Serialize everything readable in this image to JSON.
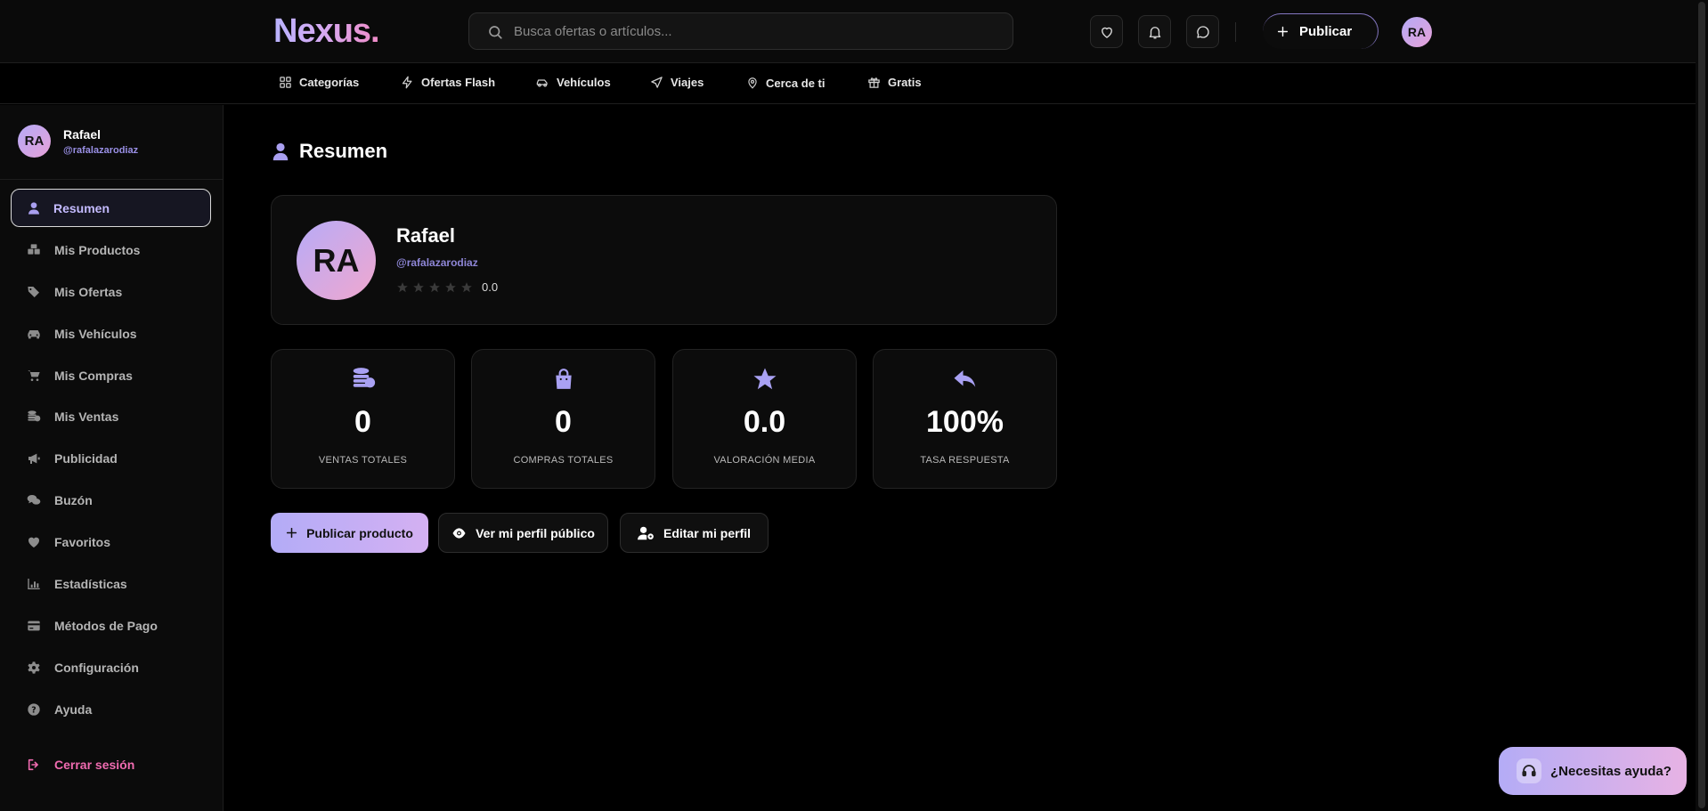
{
  "header": {
    "logo": "Nexus.",
    "search_placeholder": "Busca ofertas o artículos...",
    "publish_label": "Publicar",
    "avatar_initials": "RA"
  },
  "nav": {
    "items": [
      {
        "label": "Categorías",
        "icon": "grid-icon"
      },
      {
        "label": "Ofertas Flash",
        "icon": "lightning-icon"
      },
      {
        "label": "Vehículos",
        "icon": "car-icon"
      },
      {
        "label": "Viajes",
        "icon": "plane-icon"
      },
      {
        "label": "Cerca de ti",
        "icon": "map-pin-icon"
      },
      {
        "label": "Gratis",
        "icon": "gift-icon"
      }
    ]
  },
  "sidebar": {
    "profile": {
      "initials": "RA",
      "name": "Rafael",
      "username": "@rafalazarodiaz"
    },
    "items": [
      {
        "label": "Resumen",
        "icon": "user-icon",
        "active": true
      },
      {
        "label": "Mis Productos",
        "icon": "boxes-icon"
      },
      {
        "label": "Mis Ofertas",
        "icon": "tags-icon"
      },
      {
        "label": "Mis Vehículos",
        "icon": "car-icon"
      },
      {
        "label": "Mis Compras",
        "icon": "cart-icon"
      },
      {
        "label": "Mis Ventas",
        "icon": "coins-icon"
      },
      {
        "label": "Publicidad",
        "icon": "megaphone-icon"
      },
      {
        "label": "Buzón",
        "icon": "comments-icon"
      },
      {
        "label": "Favoritos",
        "icon": "heart-icon"
      },
      {
        "label": "Estadísticas",
        "icon": "chart-icon"
      },
      {
        "label": "Métodos de Pago",
        "icon": "credit-card-icon"
      },
      {
        "label": "Configuración",
        "icon": "gear-icon"
      },
      {
        "label": "Ayuda",
        "icon": "question-icon"
      }
    ],
    "logout_label": "Cerrar sesión"
  },
  "main": {
    "title": "Resumen",
    "profile_card": {
      "initials": "RA",
      "name": "Rafael",
      "username": "@rafalazarodiaz",
      "rating": "0.0",
      "stars_filled": 0,
      "stars_total": 5
    },
    "stats": [
      {
        "value": "0",
        "label": "VENTAS TOTALES",
        "icon": "coins-icon"
      },
      {
        "value": "0",
        "label": "COMPRAS TOTALES",
        "icon": "shopping-bag-icon"
      },
      {
        "value": "0.0",
        "label": "VALORACIÓN MEDIA",
        "icon": "star-icon"
      },
      {
        "value": "100%",
        "label": "TASA RESPUESTA",
        "icon": "reply-icon"
      }
    ],
    "actions": {
      "publish_product": "Publicar producto",
      "view_public_profile": "Ver mi perfil público",
      "edit_profile": "Editar mi perfil"
    }
  },
  "help_fab": {
    "label": "¿Necesitas ayuda?"
  },
  "colors": {
    "accent": "#b4acf6",
    "accent_pink": "#e6a1d8",
    "logout": "#f06bb0",
    "background": "#000000"
  }
}
